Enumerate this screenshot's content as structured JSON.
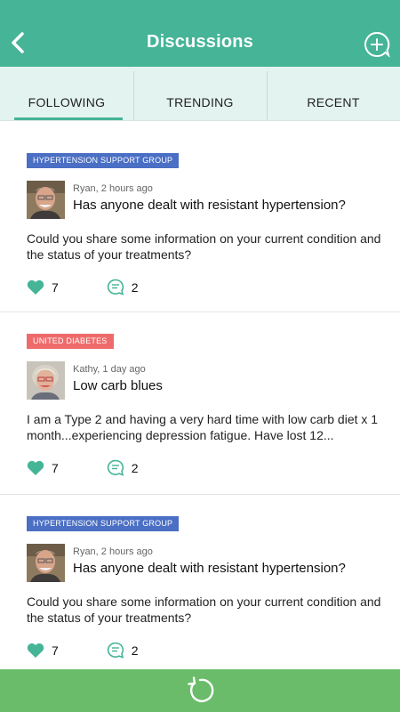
{
  "header": {
    "title": "Discussions",
    "back_icon": "chevron-left-icon",
    "new_icon": "add-comment-icon"
  },
  "tabs": [
    {
      "label": "FOLLOWING",
      "active": true
    },
    {
      "label": "TRENDING",
      "active": false
    },
    {
      "label": "RECENT",
      "active": false
    }
  ],
  "posts": [
    {
      "group": "HYPERTENSION SUPPORT GROUP",
      "group_color": "#4a6fc4",
      "author_meta": "Ryan, 2 hours ago",
      "title": "Has anyone dealt with resistant hypertension?",
      "body": "Could you share some information on your current condition and the status of your treatments?",
      "likes": "7",
      "comments": "2"
    },
    {
      "group": "UNITED DIABETES",
      "group_color": "#ef6b6b",
      "author_meta": "Kathy, 1 day ago",
      "title": "Low carb blues",
      "body": "I am a Type 2 and having a very hard time with low carb diet x 1 month...experiencing depression fatigue. Have lost 12...",
      "likes": "7",
      "comments": "2"
    },
    {
      "group": "HYPERTENSION SUPPORT GROUP",
      "group_color": "#4a6fc4",
      "author_meta": "Ryan, 2 hours ago",
      "title": "Has anyone dealt with resistant hypertension?",
      "body": "Could you share some information on your current condition and the status of your treatments?",
      "likes": "7",
      "comments": "2"
    }
  ],
  "footer": {
    "refresh_icon": "refresh-icon"
  },
  "colors": {
    "accent": "#45b497",
    "tab_bg": "#e3f3ef",
    "footer": "#6abc6a"
  }
}
